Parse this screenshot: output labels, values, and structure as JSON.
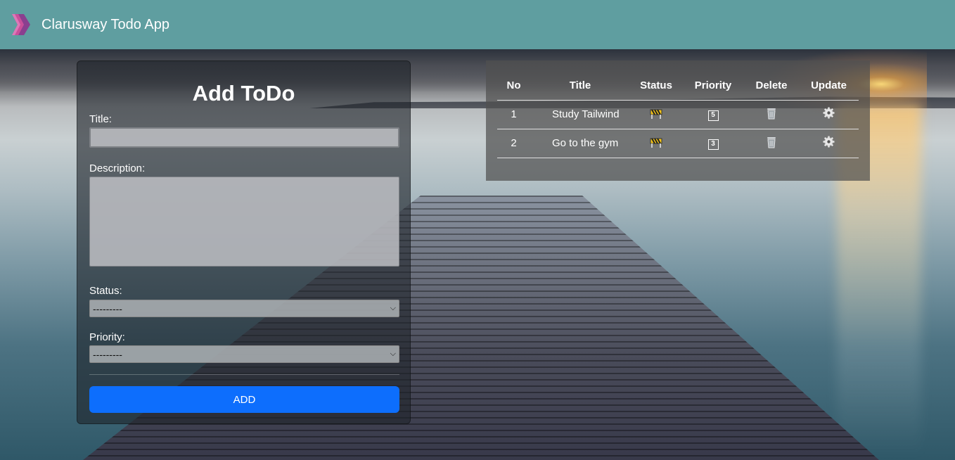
{
  "app": {
    "brand": "Clarusway Todo App"
  },
  "form": {
    "title": "Add ToDo",
    "title_label": "Title:",
    "title_value": "",
    "description_label": "Description:",
    "description_value": "",
    "status_label": "Status:",
    "status_selected": "---------",
    "priority_label": "Priority:",
    "priority_selected": "---------",
    "add_button": "ADD"
  },
  "table": {
    "headers": [
      "No",
      "Title",
      "Status",
      "Priority",
      "Delete",
      "Update"
    ],
    "rows": [
      {
        "no": "1",
        "title": "Study Tailwind",
        "status_icon": "construction-icon",
        "priority": "5",
        "delete_icon": "trash-icon",
        "update_icon": "gear-icon"
      },
      {
        "no": "2",
        "title": "Go to the gym",
        "status_icon": "construction-icon",
        "priority": "3",
        "delete_icon": "trash-icon",
        "update_icon": "gear-icon"
      }
    ]
  },
  "colors": {
    "navbar": "#5f9ea0",
    "add_button": "#0d6efd"
  }
}
